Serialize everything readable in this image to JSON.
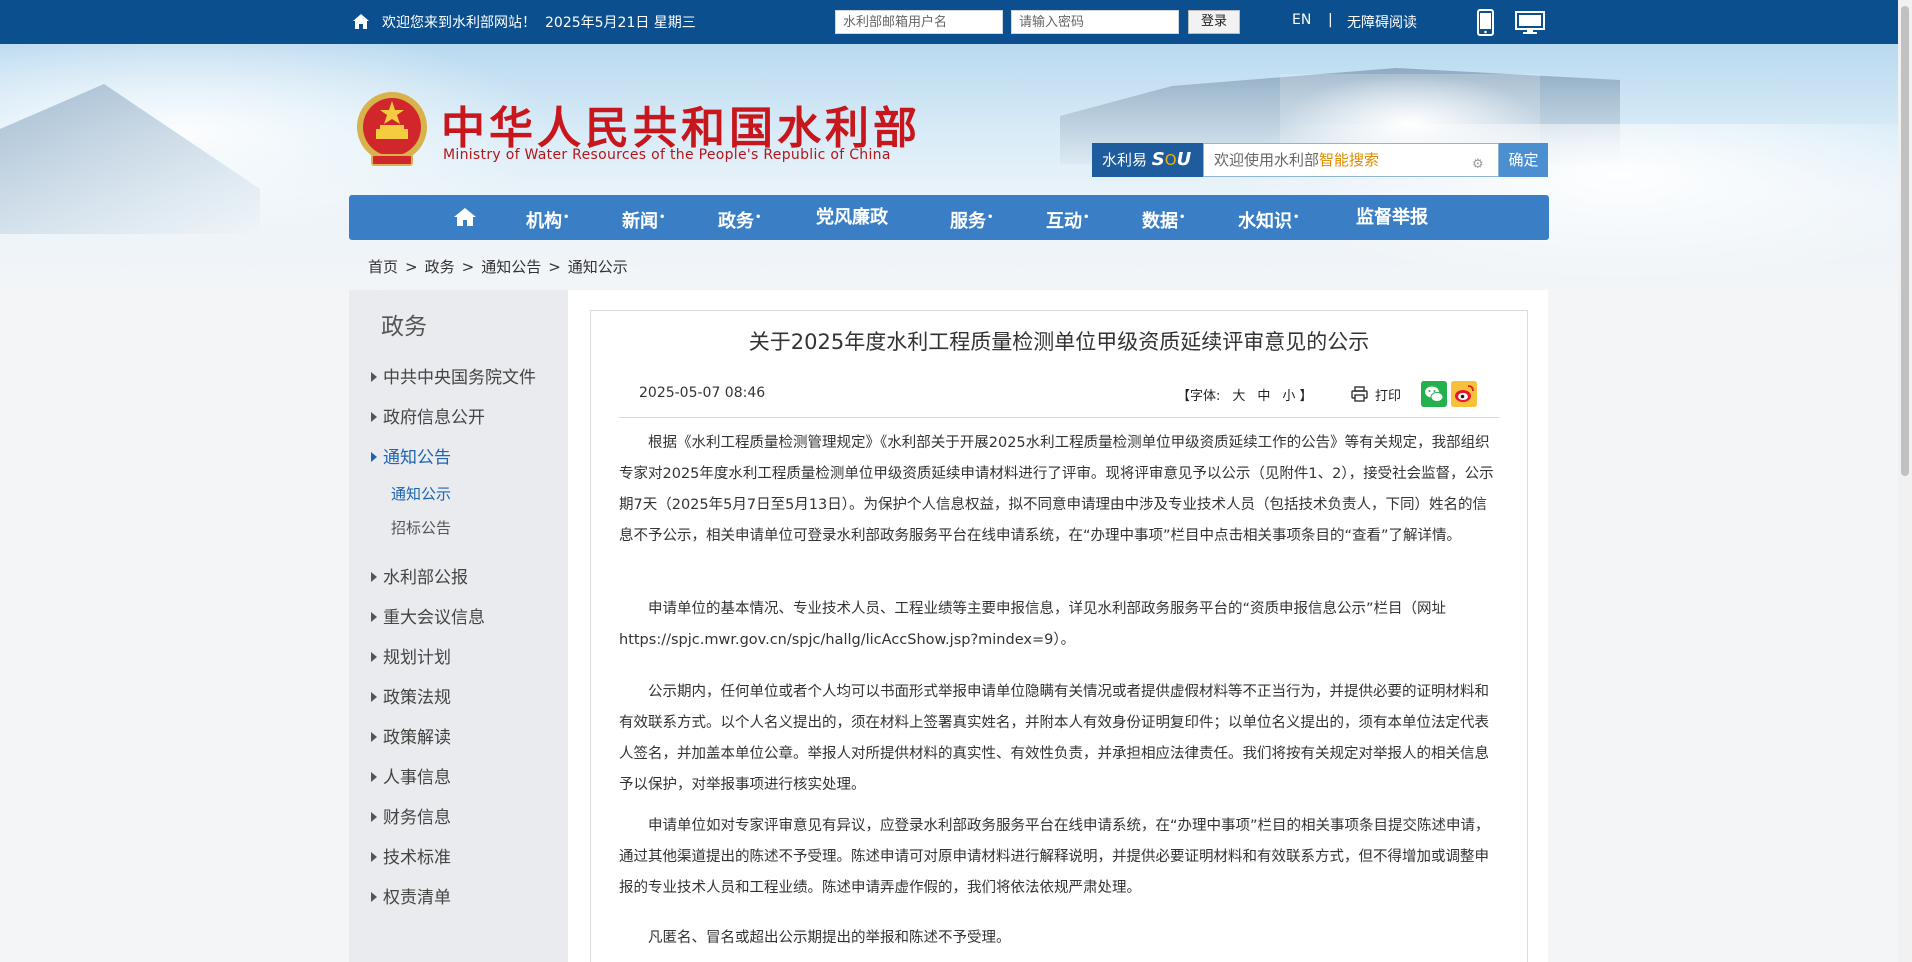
{
  "topbar": {
    "welcome": "欢迎您来到水利部网站！",
    "date": "2025年5月21日 星期三",
    "username_placeholder": "水利部邮箱用户名",
    "password_placeholder": "请输入密码",
    "login_label": "登录",
    "en_label": "EN",
    "separator": "|",
    "accessibility_label": "无障碍阅读"
  },
  "header": {
    "title_cn": "中华人民共和国水利部",
    "title_en": "Ministry of Water Resources of the People's Republic of China",
    "search_label_a": "水利易",
    "search_label_b": "S",
    "search_label_c": "O",
    "search_label_d": "U",
    "search_placeholder_a": "欢迎使用水利部",
    "search_placeholder_b": "智能搜索",
    "search_button": "确定"
  },
  "nav": {
    "items": [
      {
        "label": "机构",
        "dot": "•"
      },
      {
        "label": "新闻",
        "dot": "•"
      },
      {
        "label": "政务",
        "dot": "•"
      },
      {
        "label": "党风廉政",
        "dot": ""
      },
      {
        "label": "服务",
        "dot": "•"
      },
      {
        "label": "互动",
        "dot": "•"
      },
      {
        "label": "数据",
        "dot": "•"
      },
      {
        "label": "水知识",
        "dot": "•"
      },
      {
        "label": "监督举报",
        "dot": ""
      }
    ]
  },
  "breadcrumb": [
    "首页",
    "政务",
    "通知公告",
    "通知公示"
  ],
  "breadcrumb_sep": ">",
  "sidebar": {
    "heading": "政务",
    "items": [
      "中共中央国务院文件",
      "政府信息公开",
      "通知公告",
      "水利部公报",
      "重大会议信息",
      "规划计划",
      "政策法规",
      "政策解读",
      "人事信息",
      "财务信息",
      "技术标准",
      "权责清单"
    ],
    "subitems": [
      "通知公示",
      "招标公告"
    ]
  },
  "article": {
    "title": "关于2025年度水利工程质量检测单位甲级资质延续评审意见的公示",
    "date": "2025-05-07 08:46",
    "font_label": "【字体:",
    "font_large": "大",
    "font_medium": "中",
    "font_small": "小 】",
    "print_label": "打印",
    "paragraphs": [
      "根据《水利工程质量检测管理规定》《水利部关于开展2025水利工程质量检测单位甲级资质延续工作的公告》等有关规定，我部组织专家对2025年度水利工程质量检测单位甲级资质延续申请材料进行了评审。现将评审意见予以公示（见附件1、2），接受社会监督，公示期7天（2025年5月7日至5月13日）。为保护个人信息权益，拟不同意申请理由中涉及专业技术人员（包括技术负责人，下同）姓名的信息不予公示，相关申请单位可登录水利部政务服务平台在线申请系统，在“办理中事项”栏目中点击相关事项条目的“查看”了解详情。",
      "申请单位的基本情况、专业技术人员、工程业绩等主要申报信息，详见水利部政务服务平台的“资质申报信息公示”栏目（网址https://spjc.mwr.gov.cn/spjc/hallg/licAccShow.jsp?mindex=9）。",
      "公示期内，任何单位或者个人均可以书面形式举报申请单位隐瞒有关情况或者提供虚假材料等不正当行为，并提供必要的证明材料和有效联系方式。以个人名义提出的，须在材料上签署真实姓名，并附本人有效身份证明复印件；以单位名义提出的，须有本单位法定代表人签名，并加盖本单位公章。举报人对所提供材料的真实性、有效性负责，并承担相应法律责任。我们将按有关规定对举报人的相关信息予以保护，对举报事项进行核实处理。",
      "申请单位如对专家评审意见有异议，应登录水利部政务服务平台在线申请系统，在“办理中事项”栏目的相关事项条目提交陈述申请，通过其他渠道提出的陈述不予受理。陈述申请可对原申请材料进行解释说明，并提供必要证明材料和有效联系方式，但不得增加或调整申报的专业技术人员和工程业绩。陈述申请弄虚作假的，我们将依法依规严肃处理。",
      "凡匿名、冒名或超出公示期提出的举报和陈述不予受理。"
    ]
  }
}
